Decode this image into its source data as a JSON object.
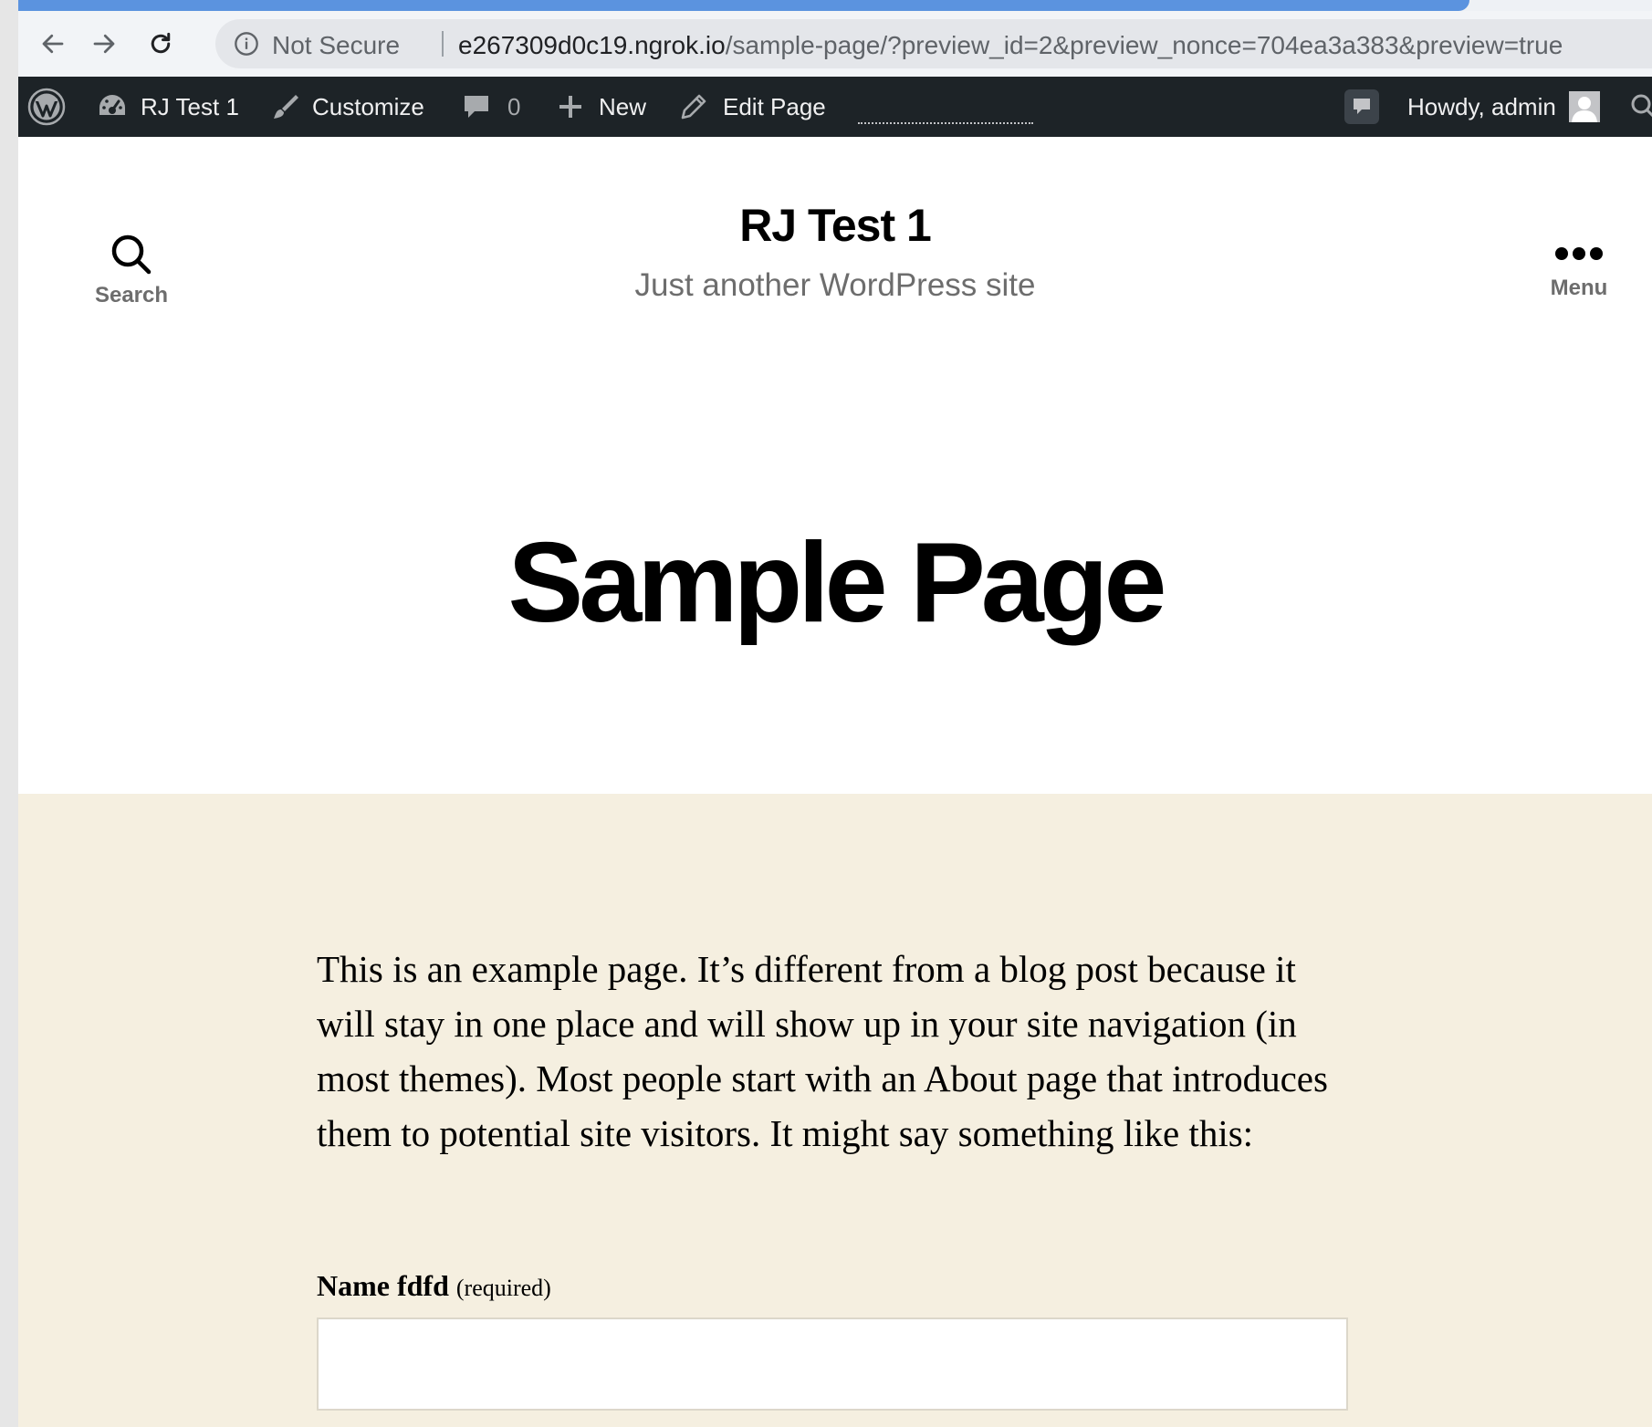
{
  "browser": {
    "security_label": "Not Secure",
    "url_host": "e267309d0c19.ngrok.io",
    "url_path": "/sample-page/?preview_id=2&preview_nonce=704ea3a383&preview=true"
  },
  "admin_bar": {
    "site_name": "RJ Test 1",
    "customize_label": "Customize",
    "comments_count": "0",
    "new_label": "New",
    "edit_label": "Edit Page",
    "greeting": "Howdy, admin"
  },
  "header": {
    "search_label": "Search",
    "site_title": "RJ Test 1",
    "site_description": "Just another WordPress site",
    "menu_label": "Menu"
  },
  "page": {
    "title": "Sample Page",
    "body": "This is an example page. It’s different from a blog post because it will stay in one place and will show up in your site navigation (in most themes). Most people start with an About page that introduces them to potential site visitors. It might say something like this:"
  },
  "form": {
    "name_label": "Name fdfd",
    "required_label": "(required)",
    "name_value": ""
  },
  "colors": {
    "admin_bar_bg": "#1d2327",
    "content_bg": "#f5efe0",
    "tab_accent": "#5b93df"
  }
}
